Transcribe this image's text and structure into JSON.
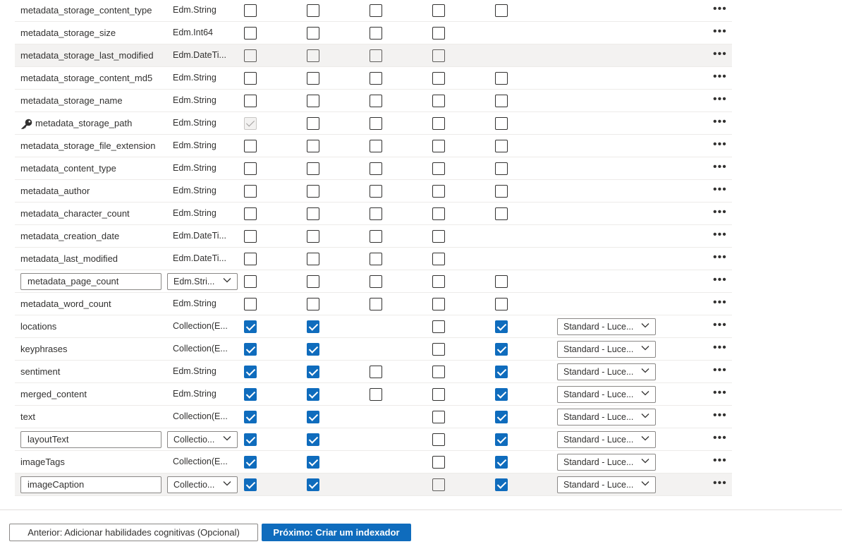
{
  "more_label": "•••",
  "colors": {
    "accent": "#0f6cbd",
    "row_highlight": "#f3f2f1"
  },
  "rows": [
    {
      "name": "metadata_storage_content_type",
      "type": "Edm.String",
      "checks": [
        "off",
        "off",
        "off",
        "off",
        "off"
      ]
    },
    {
      "name": "metadata_storage_size",
      "type": "Edm.Int64",
      "checks": [
        "off",
        "off",
        "off",
        "off",
        null
      ]
    },
    {
      "name": "metadata_storage_last_modified",
      "type": "Edm.DateTi...",
      "checks": [
        "disabled-off",
        "disabled-off",
        "disabled-off",
        "disabled-off",
        null
      ],
      "highlight": true
    },
    {
      "name": "metadata_storage_content_md5",
      "type": "Edm.String",
      "checks": [
        "off",
        "off",
        "off",
        "off",
        "off"
      ]
    },
    {
      "name": "metadata_storage_name",
      "type": "Edm.String",
      "checks": [
        "off",
        "off",
        "off",
        "off",
        "off"
      ]
    },
    {
      "name": "metadata_storage_path",
      "type": "Edm.String",
      "key": true,
      "checks": [
        "disabled",
        "off",
        "off",
        "off",
        "off"
      ]
    },
    {
      "name": "metadata_storage_file_extension",
      "type": "Edm.String",
      "checks": [
        "off",
        "off",
        "off",
        "off",
        "off"
      ]
    },
    {
      "name": "metadata_content_type",
      "type": "Edm.String",
      "checks": [
        "off",
        "off",
        "off",
        "off",
        "off"
      ]
    },
    {
      "name": "metadata_author",
      "type": "Edm.String",
      "checks": [
        "off",
        "off",
        "off",
        "off",
        "off"
      ]
    },
    {
      "name": "metadata_character_count",
      "type": "Edm.String",
      "checks": [
        "off",
        "off",
        "off",
        "off",
        "off"
      ]
    },
    {
      "name": "metadata_creation_date",
      "type": "Edm.DateTi...",
      "checks": [
        "off",
        "off",
        "off",
        "off",
        null
      ]
    },
    {
      "name": "metadata_last_modified",
      "type": "Edm.DateTi...",
      "checks": [
        "off",
        "off",
        "off",
        "off",
        null
      ]
    },
    {
      "name": "metadata_page_count",
      "type": "Edm.Stri...",
      "editable": true,
      "checks": [
        "off",
        "off",
        "off",
        "off",
        "off"
      ]
    },
    {
      "name": "metadata_word_count",
      "type": "Edm.String",
      "checks": [
        "off",
        "off",
        "off",
        "off",
        "off"
      ]
    },
    {
      "name": "locations",
      "type": "Collection(E...",
      "checks": [
        "on",
        "on",
        null,
        "off",
        "on"
      ],
      "analyzer": "Standard - Luce..."
    },
    {
      "name": "keyphrases",
      "type": "Collection(E...",
      "checks": [
        "on",
        "on",
        null,
        "off",
        "on"
      ],
      "analyzer": "Standard - Luce..."
    },
    {
      "name": "sentiment",
      "type": "Edm.String",
      "checks": [
        "on",
        "on",
        "off",
        "off",
        "on"
      ],
      "analyzer": "Standard - Luce..."
    },
    {
      "name": "merged_content",
      "type": "Edm.String",
      "checks": [
        "on",
        "on",
        "off",
        "off",
        "on"
      ],
      "analyzer": "Standard - Luce..."
    },
    {
      "name": "text",
      "type": "Collection(E...",
      "checks": [
        "on",
        "on",
        null,
        "off",
        "on"
      ],
      "analyzer": "Standard - Luce..."
    },
    {
      "name": "layoutText",
      "type": "Collectio...",
      "editable": true,
      "checks": [
        "on",
        "on",
        null,
        "off",
        "on"
      ],
      "analyzer": "Standard - Luce..."
    },
    {
      "name": "imageTags",
      "type": "Collection(E...",
      "checks": [
        "on",
        "on",
        null,
        "off",
        "on"
      ],
      "analyzer": "Standard - Luce..."
    },
    {
      "name": "imageCaption",
      "type": "Collectio...",
      "editable": true,
      "checks": [
        "on",
        "on",
        null,
        "disabled-off",
        "on"
      ],
      "analyzer": "Standard - Luce...",
      "highlight": true
    }
  ],
  "footer": {
    "prev_label": "Anterior: Adicionar habilidades cognitivas (Opcional)",
    "next_label": "Próximo: Criar um indexador"
  }
}
